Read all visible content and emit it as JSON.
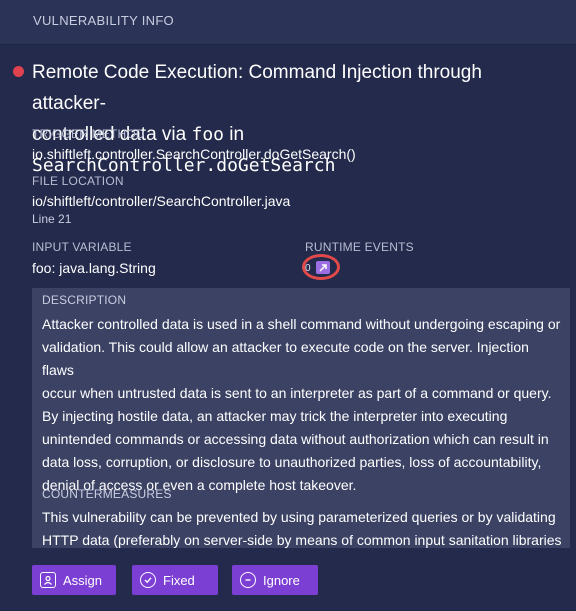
{
  "header": {
    "title": "VULNERABILITY INFO"
  },
  "vulnerability": {
    "title_part1": "Remote Code Execution: Command Injection through attacker-",
    "title_part2": "controlled data via ",
    "variable": "foo",
    "title_in": " in ",
    "method_short": "SearchController.doGetSearch",
    "severity_color": "#e0424f"
  },
  "trigger_method": {
    "label": "TRIGGER METHOD",
    "value": "io.shiftleft.controller.SearchController.doGetSearch()"
  },
  "file_location": {
    "label": "FILE LOCATION",
    "path": "io/shiftleft/controller/SearchController.java",
    "line": "Line 21"
  },
  "input_variable": {
    "label": "INPUT VARIABLE",
    "value": "foo: java.lang.String"
  },
  "runtime_events": {
    "label": "RUNTIME EVENTS",
    "count": "0",
    "icon": "external-link-icon"
  },
  "description": {
    "label": "DESCRIPTION",
    "lines": [
      "Attacker controlled data is used in a shell command without undergoing escaping or",
      "validation. This could allow an attacker to execute code on the server. Injection flaws",
      "occur when untrusted data is sent to an interpreter as part of a command or query.",
      "By injecting hostile data, an attacker may trick the interpreter into executing",
      "unintended commands or accessing data without authorization which can result in",
      "data loss, corruption, or disclosure to unauthorized parties, loss of accountability,",
      "denial of access or even a complete host takeover."
    ]
  },
  "countermeasures": {
    "label": "COUNTERMEASURES",
    "lines": [
      "This vulnerability can be prevented by using parameterized queries or by validating",
      "HTTP data (preferably on server-side by means of common input sanitation libraries"
    ]
  },
  "actions": {
    "assign": "Assign",
    "fixed": "Fixed",
    "ignore": "Ignore"
  },
  "colors": {
    "accent": "#7c3fd3",
    "background": "#232a4b",
    "highlight_ring": "#e24a4a"
  }
}
